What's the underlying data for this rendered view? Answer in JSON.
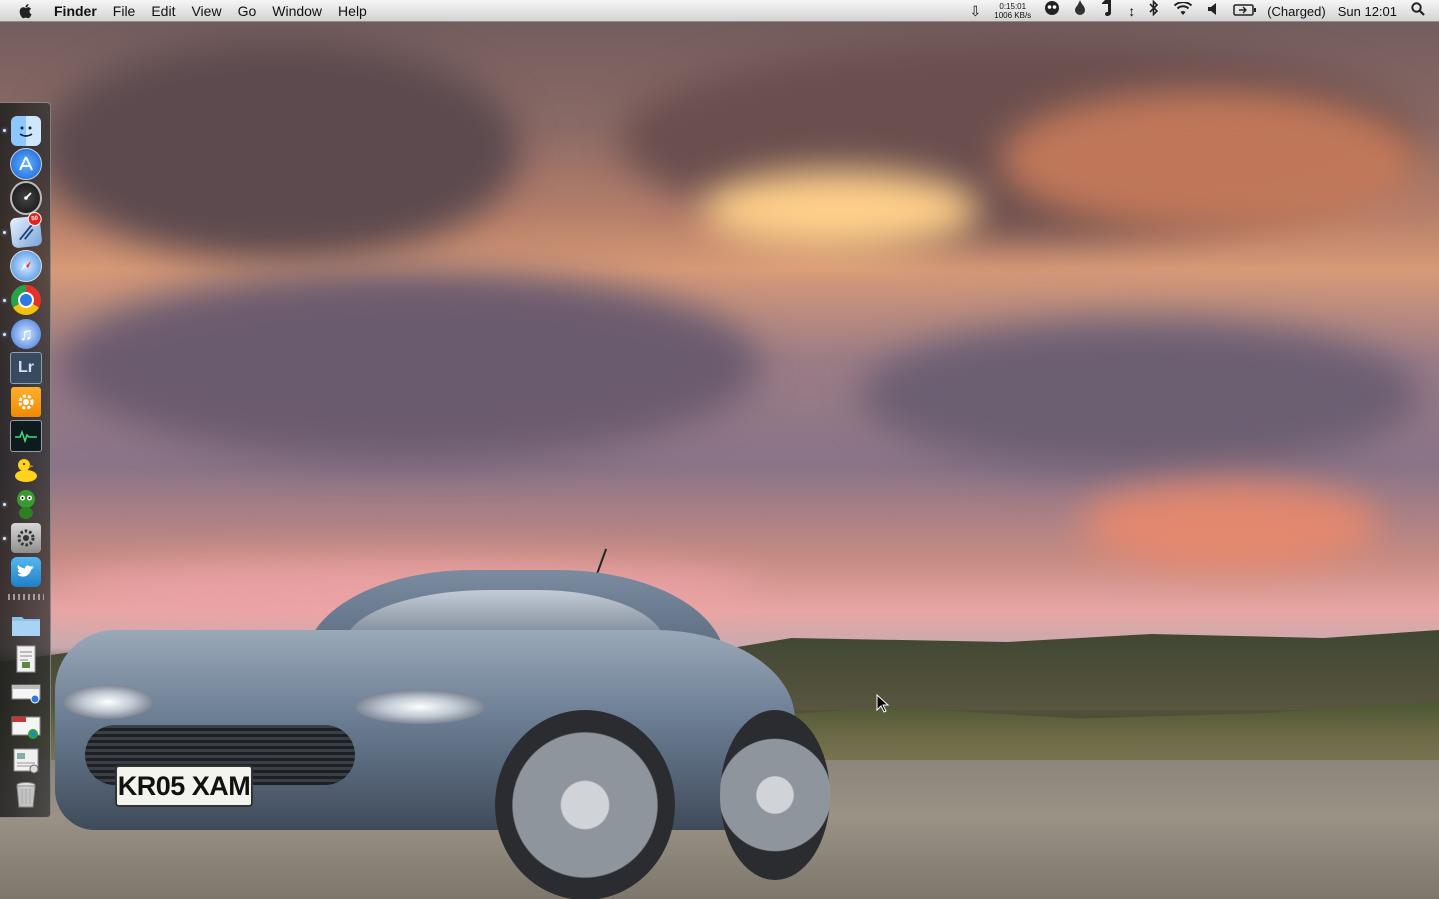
{
  "menubar": {
    "app_name": "Finder",
    "menus": [
      "File",
      "Edit",
      "View",
      "Go",
      "Window",
      "Help"
    ],
    "network_time": "0:15:01",
    "network_rate": "1006 KB/s",
    "battery_status": "(Charged)",
    "clock": "Sun 12:01",
    "status_icons": [
      "download-arrow-icon",
      "alien-icon",
      "flame-icon",
      "evernote-icon",
      "sync-arrows-icon",
      "bluetooth-icon",
      "wifi-icon",
      "volume-icon",
      "battery-icon",
      "spotlight-search-icon"
    ]
  },
  "wallpaper": {
    "license_plate": "KR05 XAM"
  },
  "dock": {
    "apps": [
      {
        "name": "finder-icon",
        "running": true
      },
      {
        "name": "app-store-icon",
        "running": false
      },
      {
        "name": "dashboard-icon",
        "running": false
      },
      {
        "name": "mail-icon",
        "running": true,
        "badge": "50"
      },
      {
        "name": "safari-icon",
        "running": false
      },
      {
        "name": "chrome-icon",
        "running": true
      },
      {
        "name": "itunes-icon",
        "running": true
      },
      {
        "name": "lightroom-icon",
        "running": false,
        "label": "Lr"
      },
      {
        "name": "preferences-gear-icon",
        "running": false
      },
      {
        "name": "activity-monitor-icon",
        "running": false
      },
      {
        "name": "adium-duck-icon",
        "running": false
      },
      {
        "name": "messenger-alien-icon",
        "running": true
      },
      {
        "name": "system-preferences-icon",
        "running": true
      },
      {
        "name": "twitter-icon",
        "running": false
      }
    ],
    "stacks": [
      {
        "name": "applications-folder-icon"
      },
      {
        "name": "documents-stack-icon"
      },
      {
        "name": "downloads-stack-icon"
      },
      {
        "name": "web-shortcut-stack-icon"
      },
      {
        "name": "screenshot-stack-icon"
      },
      {
        "name": "trash-icon"
      }
    ]
  },
  "colors": {
    "menubar_top": "#f5f5f5",
    "menubar_bottom": "#d2d2d2",
    "dock_bg": "#2a2a2a",
    "running_indicator": "#d8e8ff"
  }
}
